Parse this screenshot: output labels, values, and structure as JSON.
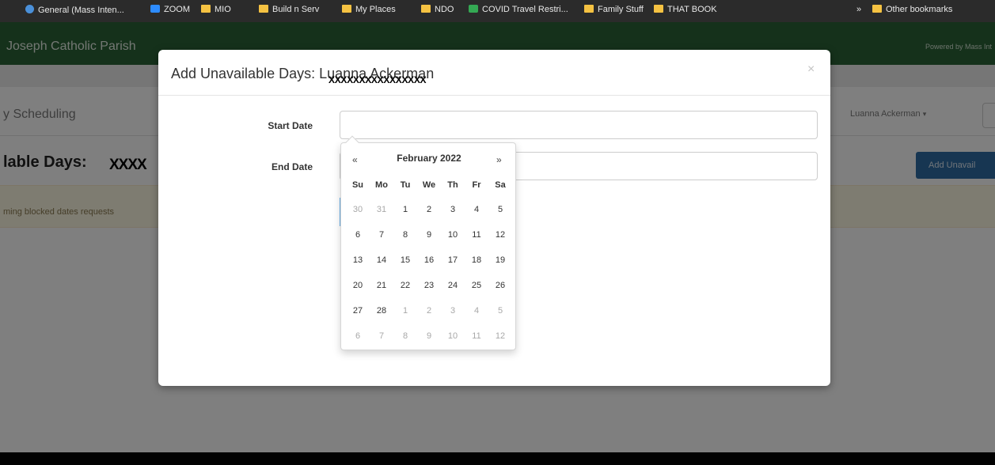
{
  "bookmarks": [
    {
      "label": "General (Mass Inten...",
      "icon": "globe-icon"
    },
    {
      "label": "ZOOM",
      "icon": "zoom-icon"
    },
    {
      "label": "MIO",
      "icon": "folder-icon"
    },
    {
      "label": "Build n Serv",
      "icon": "folder-icon"
    },
    {
      "label": "My Places",
      "icon": "folder-icon"
    },
    {
      "label": "NDO",
      "icon": "folder-icon"
    },
    {
      "label": "COVID Travel Restri...",
      "icon": "green-icon"
    },
    {
      "label": "Family Stuff",
      "icon": "folder-icon"
    },
    {
      "label": "THAT BOOK",
      "icon": "folder-icon"
    },
    {
      "label": "»",
      "icon": ""
    },
    {
      "label": "Other bookmarks",
      "icon": "folder-icon"
    }
  ],
  "navbar": {
    "brand": "Joseph Catholic Parish",
    "powered_by": "Powered by Mass Int"
  },
  "subnav": {
    "title": "y Scheduling",
    "user": "Luanna Ackerman",
    "caret": "▾"
  },
  "page": {
    "heading": "lable Days:",
    "heading_redaction": "XXXX",
    "add_button": "Add Unavail",
    "alert_text": "ming blocked dates requests"
  },
  "modal": {
    "title": "Add Unavailable Days: Luanna Ackerman",
    "redaction": "XXXXXXXXXXXXXXXX",
    "close": "×",
    "start_label": "Start Date",
    "end_label": "End Date",
    "start_value": "",
    "end_value": ""
  },
  "datepicker": {
    "prev": "«",
    "next": "»",
    "title": "February 2022",
    "weekdays": [
      "Su",
      "Mo",
      "Tu",
      "We",
      "Th",
      "Fr",
      "Sa"
    ],
    "weeks": [
      [
        {
          "d": "30",
          "k": "old"
        },
        {
          "d": "31",
          "k": "old"
        },
        {
          "d": "1",
          "k": "cur"
        },
        {
          "d": "2",
          "k": "cur"
        },
        {
          "d": "3",
          "k": "cur"
        },
        {
          "d": "4",
          "k": "cur"
        },
        {
          "d": "5",
          "k": "cur"
        }
      ],
      [
        {
          "d": "6",
          "k": "cur"
        },
        {
          "d": "7",
          "k": "cur"
        },
        {
          "d": "8",
          "k": "cur"
        },
        {
          "d": "9",
          "k": "cur"
        },
        {
          "d": "10",
          "k": "cur"
        },
        {
          "d": "11",
          "k": "cur"
        },
        {
          "d": "12",
          "k": "cur"
        }
      ],
      [
        {
          "d": "13",
          "k": "cur"
        },
        {
          "d": "14",
          "k": "cur"
        },
        {
          "d": "15",
          "k": "cur"
        },
        {
          "d": "16",
          "k": "cur"
        },
        {
          "d": "17",
          "k": "cur"
        },
        {
          "d": "18",
          "k": "cur"
        },
        {
          "d": "19",
          "k": "cur"
        }
      ],
      [
        {
          "d": "20",
          "k": "cur"
        },
        {
          "d": "21",
          "k": "cur"
        },
        {
          "d": "22",
          "k": "cur"
        },
        {
          "d": "23",
          "k": "cur"
        },
        {
          "d": "24",
          "k": "cur"
        },
        {
          "d": "25",
          "k": "cur"
        },
        {
          "d": "26",
          "k": "cur"
        }
      ],
      [
        {
          "d": "27",
          "k": "cur"
        },
        {
          "d": "28",
          "k": "cur"
        },
        {
          "d": "1",
          "k": "new"
        },
        {
          "d": "2",
          "k": "new"
        },
        {
          "d": "3",
          "k": "new"
        },
        {
          "d": "4",
          "k": "new"
        },
        {
          "d": "5",
          "k": "new"
        }
      ],
      [
        {
          "d": "6",
          "k": "new"
        },
        {
          "d": "7",
          "k": "new"
        },
        {
          "d": "8",
          "k": "new"
        },
        {
          "d": "9",
          "k": "new"
        },
        {
          "d": "10",
          "k": "new"
        },
        {
          "d": "11",
          "k": "new"
        },
        {
          "d": "12",
          "k": "new"
        }
      ]
    ]
  },
  "colors": {
    "navbar": "#2b6336",
    "primary_button": "#2e6da4",
    "alert_bg": "#fcf8e3"
  }
}
